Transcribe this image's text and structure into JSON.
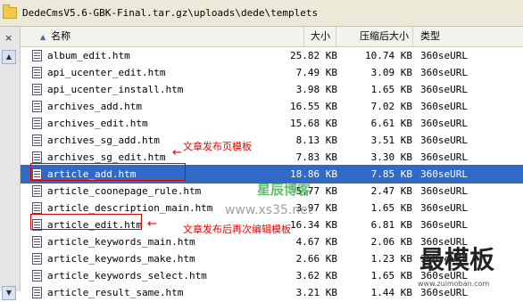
{
  "path": "DedeCmsV5.6-GBK-Final.tar.gz\\uploads\\dede\\templets",
  "left_pane": {
    "close_glyph": "×",
    "up_glyph": "▲",
    "down_glyph": "▼"
  },
  "columns": {
    "name": "名称",
    "size": "大小",
    "compressed": "压缩后大小",
    "type": "类型",
    "sort_glyph": "▲"
  },
  "files": [
    {
      "name": "album_edit.htm",
      "size": "25.82 KB",
      "compressed": "10.74 KB",
      "type": "360seURL"
    },
    {
      "name": "api_ucenter_edit.htm",
      "size": "7.49 KB",
      "compressed": "3.09 KB",
      "type": "360seURL"
    },
    {
      "name": "api_ucenter_install.htm",
      "size": "3.98 KB",
      "compressed": "1.65 KB",
      "type": "360seURL"
    },
    {
      "name": "archives_add.htm",
      "size": "16.55 KB",
      "compressed": "7.02 KB",
      "type": "360seURL"
    },
    {
      "name": "archives_edit.htm",
      "size": "15.68 KB",
      "compressed": "6.61 KB",
      "type": "360seURL"
    },
    {
      "name": "archives_sg_add.htm",
      "size": "8.13 KB",
      "compressed": "3.51 KB",
      "type": "360seURL"
    },
    {
      "name": "archives_sg_edit.htm",
      "size": "7.83 KB",
      "compressed": "3.30 KB",
      "type": "360seURL"
    },
    {
      "name": "article_add.htm",
      "size": "18.86 KB",
      "compressed": "7.85 KB",
      "type": "360seURL"
    },
    {
      "name": "article_coonepage_rule.htm",
      "size": "5.77 KB",
      "compressed": "2.47 KB",
      "type": "360seURL"
    },
    {
      "name": "article_description_main.htm",
      "size": "3.97 KB",
      "compressed": "1.65 KB",
      "type": "360seURL"
    },
    {
      "name": "article_edit.htm",
      "size": "16.34 KB",
      "compressed": "6.81 KB",
      "type": "360seURL"
    },
    {
      "name": "article_keywords_main.htm",
      "size": "4.67 KB",
      "compressed": "2.06 KB",
      "type": "360seURL"
    },
    {
      "name": "article_keywords_make.htm",
      "size": "2.66 KB",
      "compressed": "1.23 KB",
      "type": "360seURL"
    },
    {
      "name": "article_keywords_select.htm",
      "size": "3.62 KB",
      "compressed": "1.65 KB",
      "type": "360seURL"
    },
    {
      "name": "article_result_same.htm",
      "size": "3.21 KB",
      "compressed": "1.44 KB",
      "type": "360seURL"
    }
  ],
  "annotations": {
    "add_label": "文章发布页模板",
    "edit_label": "文章发布后再次编辑模板",
    "arrow": "←"
  },
  "watermarks": {
    "cn_brand": "星辰博客",
    "url": "www.xs35.net",
    "logo": "最模板",
    "logo_url": "www.zuimoban.com"
  }
}
